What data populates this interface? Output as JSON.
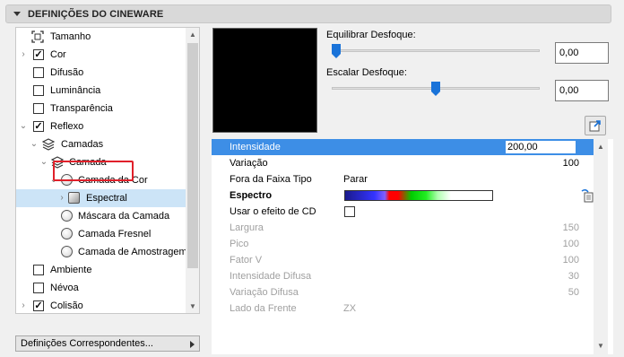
{
  "header": {
    "title": "DEFINIÇÕES DO CINEWARE"
  },
  "tree": {
    "items": [
      {
        "label": "Tamanho",
        "checked": null
      },
      {
        "label": "Cor",
        "checked": true
      },
      {
        "label": "Difusão",
        "checked": false
      },
      {
        "label": "Luminância",
        "checked": false
      },
      {
        "label": "Transparência",
        "checked": false
      },
      {
        "label": "Reflexo",
        "checked": true
      },
      {
        "label": "Camadas"
      },
      {
        "label": "Camada"
      },
      {
        "label": "Camada da Cor"
      },
      {
        "label": "Espectral",
        "selected": true
      },
      {
        "label": "Máscara da Camada"
      },
      {
        "label": "Camada Fresnel"
      },
      {
        "label": "Camada de Amostragem"
      },
      {
        "label": "Ambiente",
        "checked": false
      },
      {
        "label": "Névoa",
        "checked": false
      },
      {
        "label": "Colisão",
        "checked": true
      }
    ]
  },
  "matching_button": {
    "label": "Definições Correspondentes..."
  },
  "sliders": {
    "blur_balance": {
      "label": "Equilibrar Desfoque:",
      "value": "0,00",
      "level": 0
    },
    "blur_scale": {
      "label": "Escalar Desfoque:",
      "value": "0,00",
      "level": 0.5
    }
  },
  "properties": {
    "intensity": {
      "name": "Intensidade",
      "value": "200,00"
    },
    "variation": {
      "name": "Variação",
      "value": "100"
    },
    "out_of_range": {
      "name": "Fora da Faixa Tipo",
      "value": "Parar"
    },
    "spectrum": {
      "name": "Espectro"
    },
    "use_cd": {
      "name": "Usar o efeito de CD",
      "checked": false
    },
    "width": {
      "name": "Largura",
      "value": "150"
    },
    "peak": {
      "name": "Pico",
      "value": "100"
    },
    "factor_v": {
      "name": "Fator V",
      "value": "100"
    },
    "diffuse_intensity": {
      "name": "Intensidade Difusa",
      "value": "30"
    },
    "diffuse_variation": {
      "name": "Variação Difusa",
      "value": "50"
    },
    "front_side": {
      "name": "Lado da Frente",
      "value": "ZX"
    }
  },
  "colors": {
    "selection": "#3d8ee6",
    "tree_selection": "#cce4f7",
    "highlight": "#e0202a"
  },
  "icons": [
    "collapse-triangle-icon",
    "size-icon",
    "layers-icon",
    "radio-icon",
    "spectral-icon",
    "edit-spectrum-icon",
    "export-icon"
  ]
}
